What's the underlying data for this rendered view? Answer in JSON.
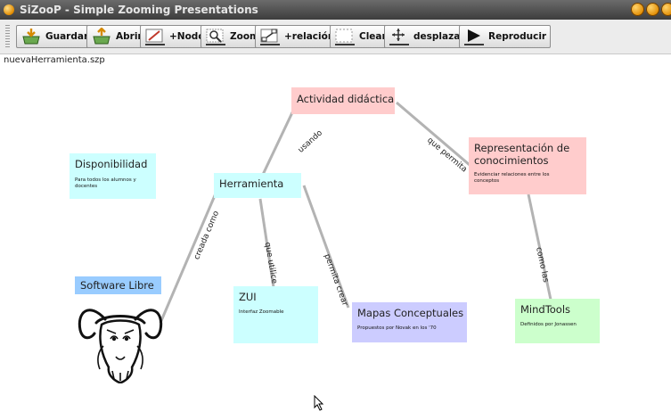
{
  "window": {
    "title": "SiZooP - Simple Zooming Presentations"
  },
  "toolbar": {
    "buttons": [
      {
        "label": "Guardar",
        "icon": "save-icon"
      },
      {
        "label": "Abrir",
        "icon": "open-icon"
      },
      {
        "label": "+Nodo",
        "icon": "add-node-icon"
      },
      {
        "label": "Zoom",
        "icon": "zoom-icon"
      },
      {
        "label": "+relación",
        "icon": "add-relation-icon"
      },
      {
        "label": "Clear",
        "icon": "clear-icon"
      },
      {
        "label": "desplazar",
        "icon": "move-icon"
      },
      {
        "label": "Reproducir",
        "icon": "play-icon"
      }
    ]
  },
  "file": {
    "name": "nuevaHerramienta.szp"
  },
  "nodes": {
    "actividad": {
      "title": "Actividad didáctica",
      "color": "#ffcccc"
    },
    "disponibilidad": {
      "title": "Disponibilidad",
      "desc": "Para todos los alumnos y docentes",
      "color": "#ccffff"
    },
    "herramienta": {
      "title": "Herramienta",
      "color": "#ccffff"
    },
    "representacion": {
      "title": "Representación de conocimientos",
      "desc": "Evidenciar relaciones entre los conceptos",
      "color": "#ffcccc"
    },
    "software": {
      "title": "Software Libre",
      "color": "#99ccff"
    },
    "zui": {
      "title": "ZUI",
      "desc": "Interfaz Zoomable",
      "color": "#ccffff"
    },
    "mapas": {
      "title": "Mapas Conceptuales",
      "desc": "Propuestos por Novak en los '70",
      "color": "#ccccff"
    },
    "mindtools": {
      "title": "MindTools",
      "desc": "Definidos por Jonassen",
      "color": "#ccffcc"
    }
  },
  "edges": {
    "usando": "usando",
    "que_permita": "que permita",
    "creada_como": "creada como",
    "que_utilice": "que utilice",
    "permita_crear": "permita crear",
    "como_las": "como las"
  },
  "colors": {
    "edge": "#b3b3b3",
    "titlebar": "#4a4a4a",
    "toolbar": "#ececec"
  }
}
